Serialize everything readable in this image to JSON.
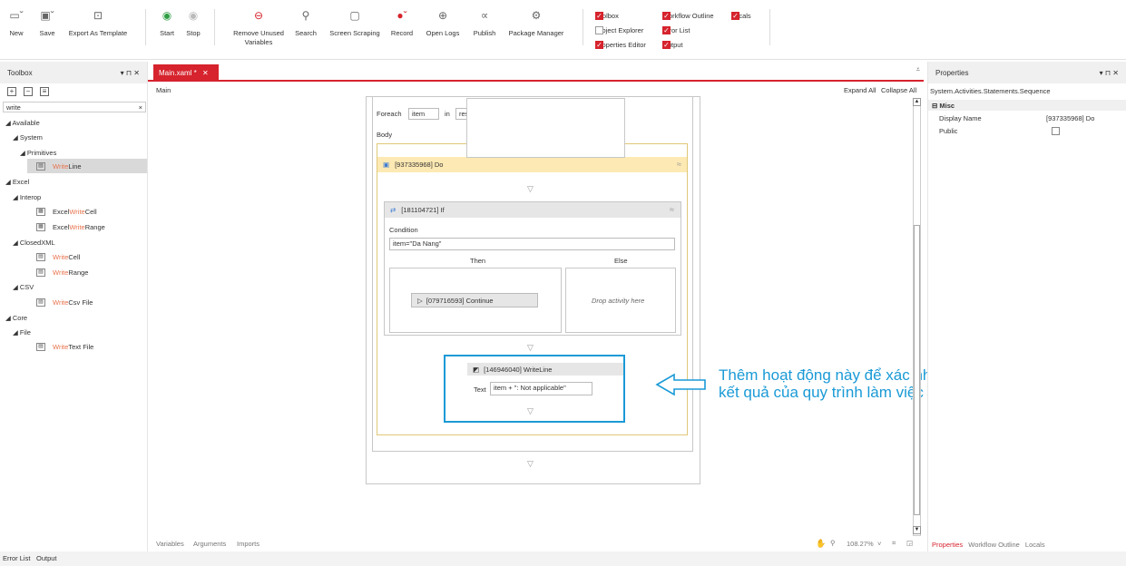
{
  "ribbon": {
    "new_label": "New",
    "save_label": "Save",
    "export_label": "Export As Template",
    "start_label": "Start",
    "stop_label": "Stop",
    "remove_unused_label_1": "Remove Unused",
    "remove_unused_label_2": "Variables",
    "search_label": "Search",
    "screen_scraping_label": "Screen Scraping",
    "record_label": "Record",
    "open_logs_label": "Open Logs",
    "publish_label": "Publish",
    "package_manager_label": "Package Manager",
    "checks": {
      "toolbox": "Toolbox",
      "workflow_outline": "Workflow Outline",
      "locals": "Locals",
      "project_explorer": "Project Explorer",
      "error_list": "Error List",
      "properties_editor": "Properties Editor",
      "output": "Output"
    }
  },
  "toolbox": {
    "title": "Toolbox",
    "pin": "▾ ⊓ ✕",
    "search_value": "write",
    "clear": "×",
    "items": {
      "available": "◢ Available",
      "system": "◢ System",
      "primitives": "◢ Primitives",
      "writeline_hl": "Write",
      "writeline_rest": "Line",
      "excel": "◢ Excel",
      "interop": "◢ Interop",
      "excel_write_cell_a": "Excel ",
      "excel_write_cell_hl": "Write",
      "excel_write_cell_b": " Cell",
      "excel_write_range_a": "Excel ",
      "excel_write_range_hl": "Write",
      "excel_write_range_b": " Range",
      "closedxml": "◢ ClosedXML",
      "write_cell_hl": "Write",
      "write_cell_b": " Cell",
      "write_range_hl": "Write",
      "write_range_b": " Range",
      "csv": "◢ CSV",
      "write_csv_hl": "Write",
      "write_csv_b": " Csv File",
      "core": "◢ Core",
      "file": "◢ File",
      "write_text_hl": "Write",
      "write_text_b": " Text File"
    }
  },
  "doc": {
    "tab_label": "Main.xaml *",
    "tab_close": "✕",
    "breadcrumb": "Main",
    "expand_all": "Expand All",
    "collapse_all": "Collapse All"
  },
  "designer": {
    "foreach_label": "Foreach",
    "foreach_item": "item",
    "in_label": "in",
    "foreach_source": "result",
    "body_label": "Body",
    "do_title": "[937335968] Do",
    "if_title": "[181104721] If",
    "condition_label": "Condition",
    "condition_value": "item=\"Da Nang\"",
    "then_label": "Then",
    "else_label": "Else",
    "continue_title": "[079716593] Continue",
    "drop_hint": "Drop activity here",
    "writeline_title": "[146946040] WriteLine",
    "text_label": "Text",
    "text_value": "item + \": Not applicable\"",
    "annotation_line1": "Thêm hoạt động này để xác nhận",
    "annotation_line2": "kết quả của quy trình làm việc",
    "annotation_color": "#1a9ad6"
  },
  "bottom_bar": {
    "variables": "Variables",
    "arguments": "Arguments",
    "imports": "Imports",
    "zoom": "108.27%"
  },
  "properties": {
    "title": "Properties",
    "pin": "▾ ⊓ ✕",
    "type_name": "System.Activities.Statements.Sequence",
    "category": "Misc",
    "rows": [
      {
        "name": "Display Name",
        "value": "[937335968] Do"
      },
      {
        "name": "Public",
        "value": ""
      }
    ],
    "tabs": {
      "properties": "Properties",
      "workflow_outline": "Workflow Outline",
      "locals": "Locals"
    }
  },
  "status": {
    "error_list": "Error List",
    "output": "Output"
  },
  "colors": {
    "accent": "#d6232d",
    "highlight": "#e8734d",
    "do_header": "#fde9b3"
  }
}
